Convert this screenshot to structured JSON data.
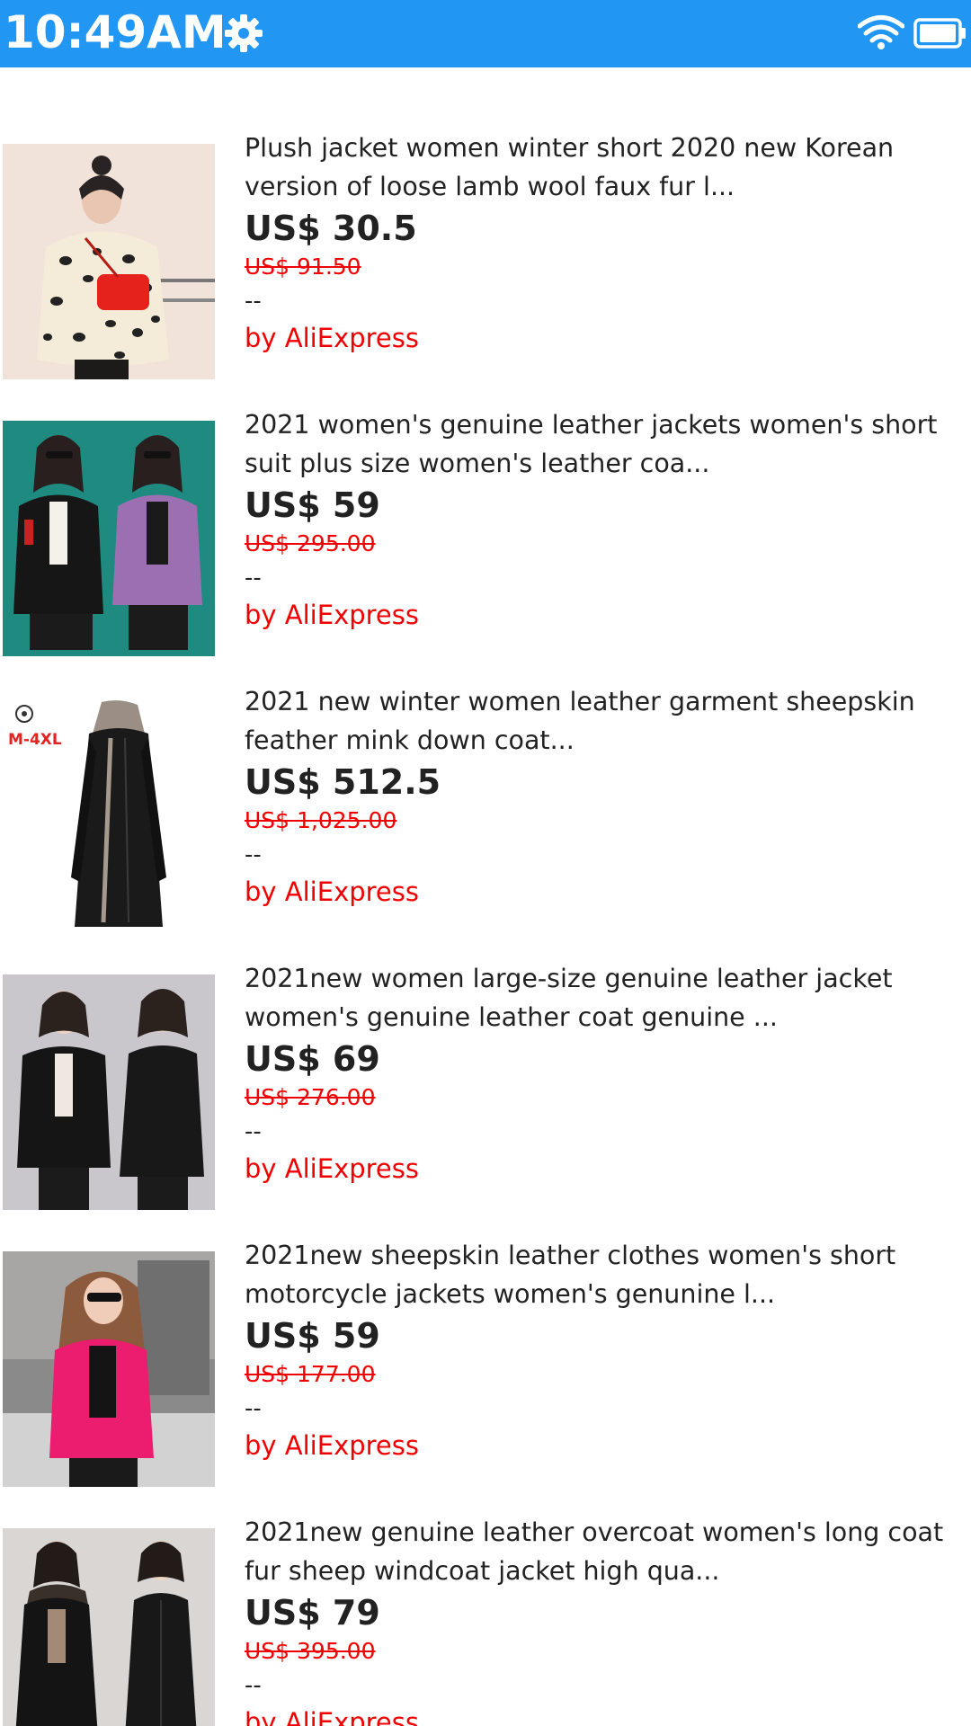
{
  "status_bar": {
    "time": "10:49AM",
    "settings_icon": "gear-icon",
    "wifi_icon": "wifi-icon",
    "battery_icon": "battery-icon",
    "background_color": "#2196f3"
  },
  "products": [
    {
      "title": "Plush jacket women winter short 2020 new Korean version of loose lamb wool faux fur l...",
      "price": "US$ 30.5",
      "original_price": "US$ 91.50",
      "shipping": "--",
      "seller": "by AliExpress"
    },
    {
      "title": "2021 women's genuine leather jackets women's short suit plus size women's leather coa...",
      "price": "US$ 59",
      "original_price": "US$ 295.00",
      "shipping": "--",
      "seller": "by AliExpress"
    },
    {
      "title": "2021 new winter women leather garment sheepskin feather mink down coat...",
      "price": "US$ 512.5",
      "original_price": "US$ 1,025.00",
      "shipping": "--",
      "seller": "by AliExpress",
      "image_badge": "M-4XL"
    },
    {
      "title": "2021new women large-size genuine leather jacket women's genuine leather coat genuine ...",
      "price": "US$ 69",
      "original_price": "US$ 276.00",
      "shipping": "--",
      "seller": "by AliExpress"
    },
    {
      "title": "2021new sheepskin leather clothes women's short motorcycle jackets women's genunine l...",
      "price": "US$ 59",
      "original_price": "US$ 177.00",
      "shipping": "--",
      "seller": "by AliExpress"
    },
    {
      "title": "2021new genuine leather overcoat women's long coat fur sheep windcoat jacket high qua...",
      "price": "US$ 79",
      "original_price": "US$ 395.00",
      "shipping": "--",
      "seller": "by AliExpress"
    }
  ],
  "colors": {
    "accent": "#2196f3",
    "price_text": "#222222",
    "strike_price": "#f00000",
    "seller_text": "#f00000"
  }
}
